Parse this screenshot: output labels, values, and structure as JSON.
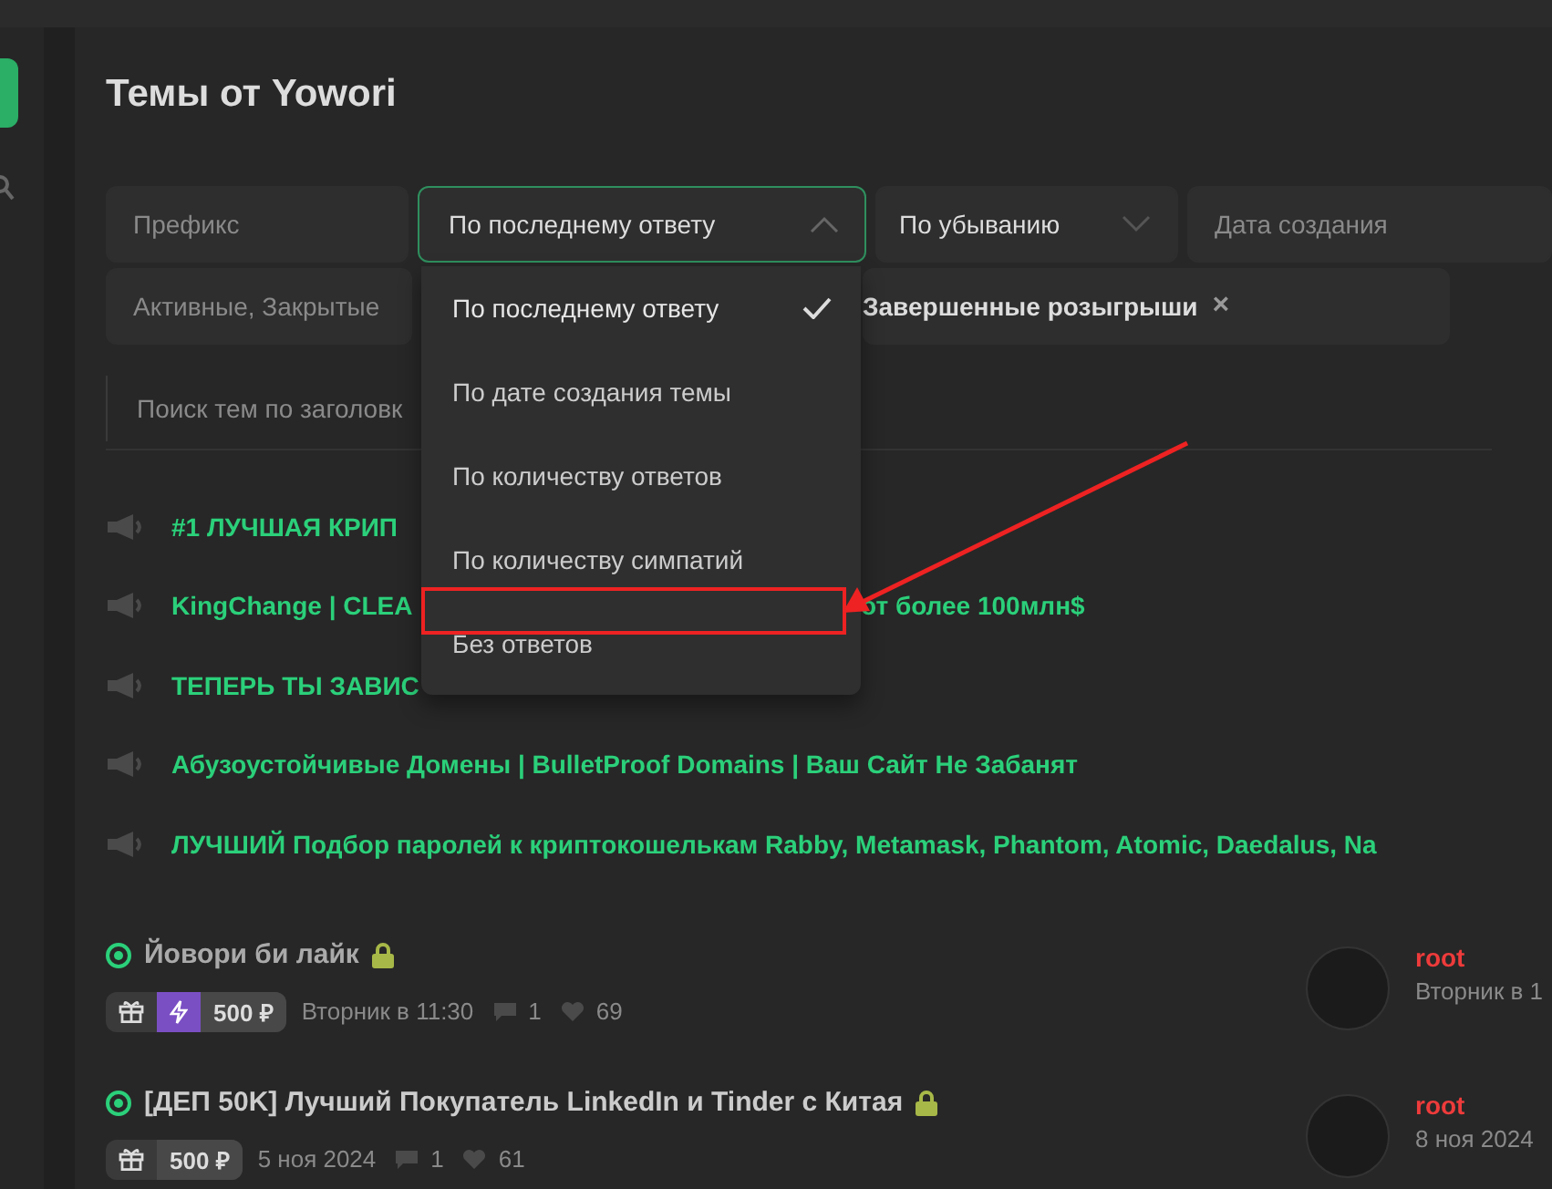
{
  "page": {
    "title": "Темы от Yowori"
  },
  "filters": {
    "prefix": {
      "placeholder": "Префикс"
    },
    "sort": {
      "value": "По последнему ответу",
      "expanded": true
    },
    "order": {
      "value": "По убыванию"
    },
    "date": {
      "placeholder": "Дата создания"
    },
    "state": {
      "value": "Активные, Закрытые"
    },
    "tags": [
      {
        "label": "Завершенные розыгрыши",
        "remove": "×"
      }
    ]
  },
  "search": {
    "placeholder": "Поиск тем по заголовк"
  },
  "sort_menu": [
    {
      "label": "По последнему ответу",
      "selected": true
    },
    {
      "label": "По дате создания темы",
      "selected": false
    },
    {
      "label": "По количеству ответов",
      "selected": false
    },
    {
      "label": "По количеству симпатий",
      "selected": false
    },
    {
      "label": "Без ответов",
      "selected": false
    }
  ],
  "sticky_threads": [
    {
      "title": "#1 ЛУЧШАЯ КРИП"
    },
    {
      "title": "KingChange | CLEA",
      "title_end": "от более 100млн$"
    },
    {
      "title": "ТЕПЕРЬ ТЫ ЗАВИС"
    },
    {
      "title": "Абузоустойчивые Домены | BulletProof Domains | Ваш Сайт Не Забанят"
    },
    {
      "title": "ЛУЧШИЙ Подбор паролей к криптокошелькам Rabby, Metamask, Phantom, Atomic, Daedalus, Na"
    }
  ],
  "threads": [
    {
      "title": "Йовори би лайк",
      "locked": true,
      "badges": [
        {
          "kind": "gift"
        },
        {
          "kind": "boost"
        },
        {
          "kind": "price",
          "text": "500 ₽"
        }
      ],
      "date": "Вторник в 11:30",
      "replies": "1",
      "likes": "69",
      "last_poster": "root",
      "last_date": "Вторник в 1"
    },
    {
      "title": "[ДЕП 50K] Лучший Покупатель LinkedIn и Tinder с Китая",
      "locked": true,
      "badges": [
        {
          "kind": "gift"
        },
        {
          "kind": "price",
          "text": "500 ₽"
        }
      ],
      "date": "5 ноя 2024",
      "replies": "1",
      "likes": "61",
      "last_poster": "root",
      "last_date": "8 ноя 2024"
    }
  ]
}
